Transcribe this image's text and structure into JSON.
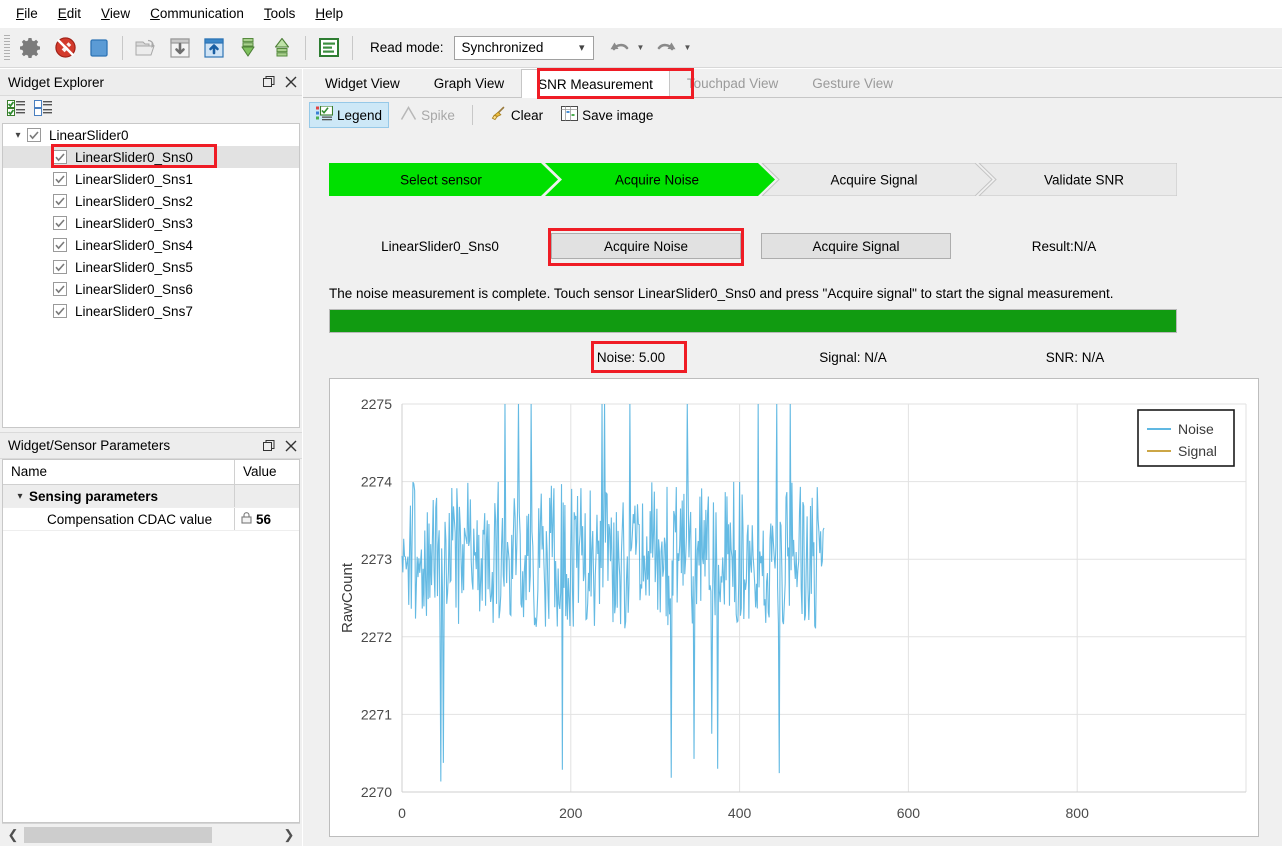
{
  "menu": {
    "items": [
      {
        "label": "File",
        "accel": "F"
      },
      {
        "label": "Edit",
        "accel": "E"
      },
      {
        "label": "View",
        "accel": "V"
      },
      {
        "label": "Communication",
        "accel": "C"
      },
      {
        "label": "Tools",
        "accel": "T"
      },
      {
        "label": "Help",
        "accel": "H"
      }
    ]
  },
  "toolbar": {
    "read_mode_label": "Read mode:",
    "read_mode_value": "Synchronized",
    "icons": [
      "gear-icon",
      "disconnect-icon",
      "stop-icon",
      "open-project-icon",
      "download-icon",
      "upload-icon",
      "read-all-icon",
      "write-all-icon",
      "log-icon"
    ]
  },
  "widget_explorer": {
    "title": "Widget Explorer",
    "mini_toolbar": [
      "check-all-icon",
      "uncheck-all-icon"
    ],
    "tree": {
      "root": {
        "label": "LinearSlider0",
        "checked": true,
        "expanded": true
      },
      "children": [
        {
          "label": "LinearSlider0_Sns0",
          "checked": true,
          "selected": true,
          "highlighted": true
        },
        {
          "label": "LinearSlider0_Sns1",
          "checked": true
        },
        {
          "label": "LinearSlider0_Sns2",
          "checked": true
        },
        {
          "label": "LinearSlider0_Sns3",
          "checked": true
        },
        {
          "label": "LinearSlider0_Sns4",
          "checked": true
        },
        {
          "label": "LinearSlider0_Sns5",
          "checked": true
        },
        {
          "label": "LinearSlider0_Sns6",
          "checked": true
        },
        {
          "label": "LinearSlider0_Sns7",
          "checked": true
        }
      ]
    }
  },
  "params_panel": {
    "title": "Widget/Sensor Parameters",
    "columns": [
      "Name",
      "Value"
    ],
    "group": "Sensing parameters",
    "rows": [
      {
        "name": "Compensation CDAC value",
        "value": "56",
        "icon": "lock-icon"
      }
    ]
  },
  "tabs": [
    {
      "label": "Widget View",
      "active": false,
      "disabled": false
    },
    {
      "label": "Graph View",
      "active": false,
      "disabled": false
    },
    {
      "label": "SNR Measurement",
      "active": true,
      "disabled": false,
      "highlighted": true
    },
    {
      "label": "Touchpad View",
      "active": false,
      "disabled": true
    },
    {
      "label": "Gesture View",
      "active": false,
      "disabled": true
    }
  ],
  "view_toolbar": [
    {
      "label": "Legend",
      "icon": "legend-icon",
      "toggled": true,
      "disabled": false
    },
    {
      "label": "Spike",
      "icon": "spike-icon",
      "toggled": false,
      "disabled": true
    },
    {
      "label": "Clear",
      "icon": "broom-icon",
      "toggled": false,
      "disabled": false
    },
    {
      "label": "Save image",
      "icon": "save-image-icon",
      "toggled": false,
      "disabled": false
    }
  ],
  "wizard": {
    "steps": [
      {
        "label": "Select sensor",
        "state": "done"
      },
      {
        "label": "Acquire Noise",
        "state": "active"
      },
      {
        "label": "Acquire Signal",
        "state": "pending"
      },
      {
        "label": "Validate SNR",
        "state": "pending"
      }
    ],
    "done_color": "#00e000",
    "pending_color": "#eaeaea"
  },
  "measurement": {
    "sensor_name": "LinearSlider0_Sns0",
    "acquire_noise_button": "Acquire Noise",
    "acquire_signal_button": "Acquire Signal",
    "result_text": "Result:N/A",
    "status_message": "The noise measurement is complete. Touch sensor LinearSlider0_Sns0 and press \"Acquire signal\" to start the signal measurement.",
    "progress_percent": 100,
    "progress_color": "#119b11",
    "metrics": [
      {
        "label": "Noise:",
        "value": "5.00",
        "highlighted": true
      },
      {
        "label": "Signal:",
        "value": "N/A",
        "highlighted": false
      },
      {
        "label": "SNR:",
        "value": "N/A",
        "highlighted": false
      }
    ]
  },
  "highlight_color": "#ef1c25",
  "chart_data": {
    "type": "line",
    "title": "",
    "xlabel": "",
    "ylabel": "RawCount",
    "xlim": [
      0,
      1000
    ],
    "ylim": [
      2270,
      2275
    ],
    "xticks": [
      0,
      200,
      400,
      600,
      800
    ],
    "yticks": [
      2270,
      2271,
      2272,
      2273,
      2274,
      2275
    ],
    "grid": true,
    "legend_position": "top-right",
    "series": [
      {
        "name": "Noise",
        "color": "#49aede",
        "visible": true
      },
      {
        "name": "Signal",
        "color": "#c49a2b",
        "visible": false
      }
    ],
    "noise_x_range": [
      0,
      500
    ],
    "noise_baseline": 2273,
    "noise_min": 2270,
    "noise_max": 2275,
    "noise_typical_band": [
      2272,
      2274
    ],
    "samples_count": 500,
    "note": "Dense noise trace oscillating mostly between 2272 and 2274 with occasional spikes to 2275 and dips to 2270"
  }
}
